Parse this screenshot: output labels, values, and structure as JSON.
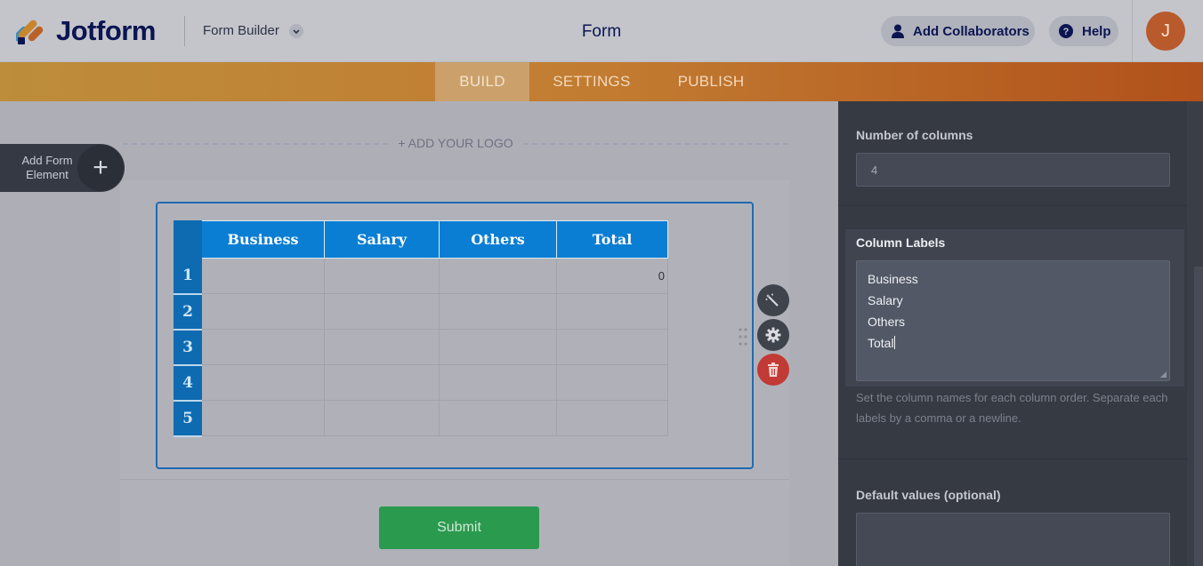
{
  "header": {
    "brand": "Jotform",
    "builder_label": "Form Builder",
    "page_title": "Form",
    "collab_label": "Add Collaborators",
    "help_label": "Help",
    "avatar_initial": "J"
  },
  "nav": {
    "tabs": [
      {
        "label": "BUILD",
        "active": true
      },
      {
        "label": "SETTINGS",
        "active": false
      },
      {
        "label": "PUBLISH",
        "active": false
      }
    ]
  },
  "canvas": {
    "add_logo": "+ ADD YOUR LOGO",
    "add_element_label": "Add Form Element",
    "submit_label": "Submit"
  },
  "matrix": {
    "columns": [
      "Business",
      "Salary",
      "Others",
      "Total"
    ],
    "rows": [
      {
        "num": "1",
        "cells": [
          "",
          "",
          "",
          "0"
        ]
      },
      {
        "num": "2",
        "cells": [
          "",
          "",
          "",
          ""
        ]
      },
      {
        "num": "3",
        "cells": [
          "",
          "",
          "",
          ""
        ]
      },
      {
        "num": "4",
        "cells": [
          "",
          "",
          "",
          ""
        ]
      },
      {
        "num": "5",
        "cells": [
          "",
          "",
          "",
          ""
        ]
      }
    ]
  },
  "panel": {
    "num_columns_label": "Number of columns",
    "num_columns_value": "4",
    "column_labels_label": "Column Labels",
    "column_labels_lines": [
      "Business",
      "Salary",
      "Others",
      "Total"
    ],
    "column_labels_help": "Set the column names for each column order. Separate each labels by a comma or a newline.",
    "default_values_label": "Default values (optional)"
  },
  "colors": {
    "brand_navy": "#0a1551",
    "nav_orange": "#c27c31",
    "table_header_blue": "#0a7ed3",
    "submit_green": "#2a9a4f",
    "delete_red": "#c23a35",
    "panel_bg": "#363a43"
  }
}
